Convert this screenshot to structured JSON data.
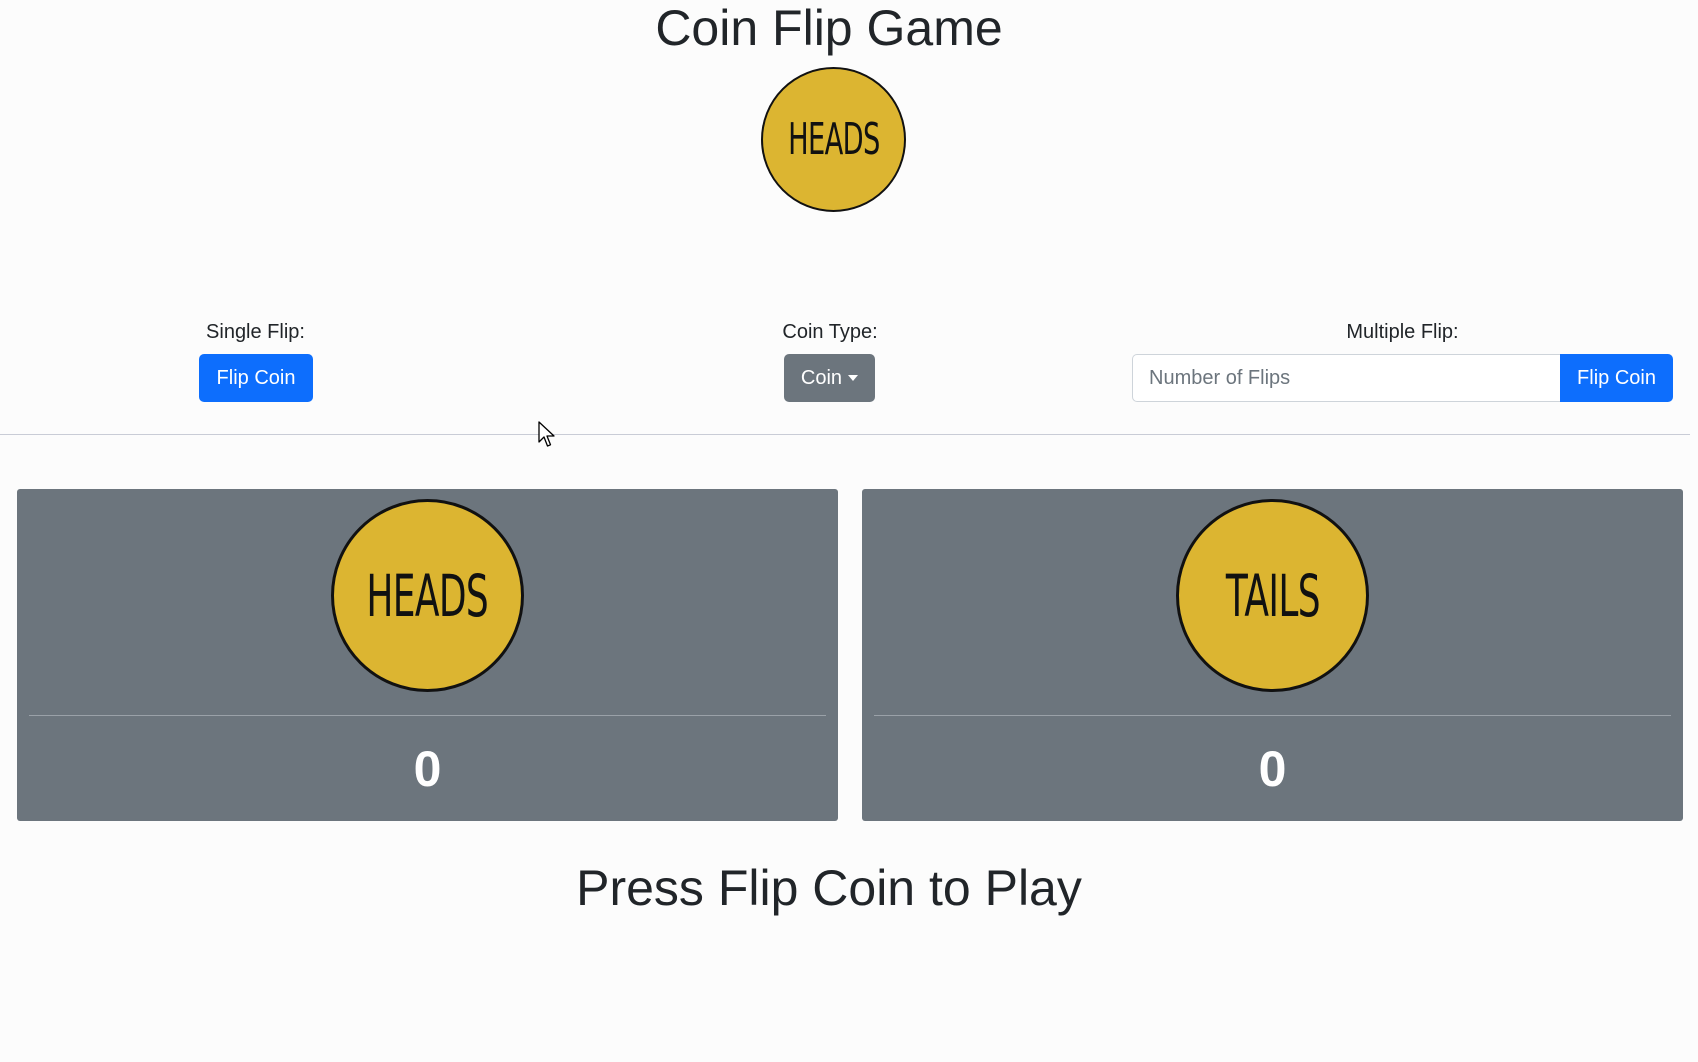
{
  "title": "Coin Flip Game",
  "main_coin": {
    "face": "HEADS"
  },
  "controls": {
    "single": {
      "label": "Single Flip:",
      "button": "Flip Coin"
    },
    "coin_type": {
      "label": "Coin Type:",
      "button": "Coin"
    },
    "multiple": {
      "label": "Multiple Flip:",
      "placeholder": "Number of Flips",
      "value": "",
      "button": "Flip Coin"
    }
  },
  "results": {
    "heads": {
      "face": "HEADS",
      "count": "0"
    },
    "tails": {
      "face": "TAILS",
      "count": "0"
    }
  },
  "status": "Press Flip Coin to Play",
  "colors": {
    "coin_gold": "#dcb531",
    "primary_blue": "#0d6efd",
    "secondary_gray": "#6c757d",
    "background": "#fcfcfc"
  },
  "icons": {
    "cursor": "mouse-pointer-icon",
    "dropdown": "caret-down-icon"
  }
}
